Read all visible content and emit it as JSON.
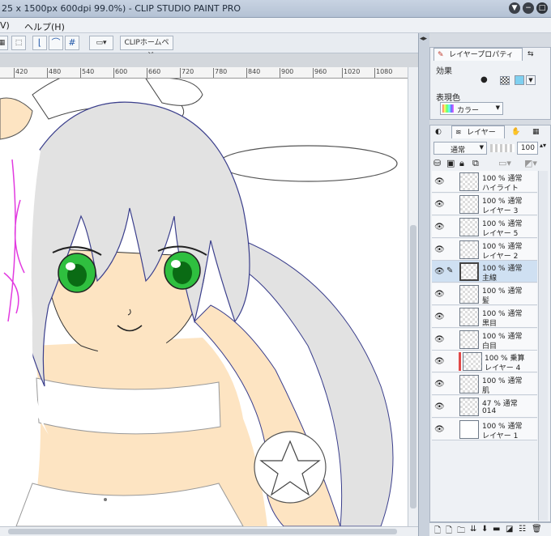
{
  "window": {
    "title": "25 x 1500px 600dpi 99.0%)  - CLIP STUDIO PAINT PRO",
    "controls": [
      "▼",
      "−",
      "□",
      "✕"
    ]
  },
  "menu": {
    "items": [
      "V)",
      "ヘルプ(H)"
    ]
  },
  "toolbar": {
    "clip_home_label": "CLIPホームページ"
  },
  "ruler": {
    "ticks": [
      "420",
      "480",
      "540",
      "600",
      "660",
      "720",
      "780",
      "840",
      "900",
      "960",
      "1020",
      "1080"
    ]
  },
  "layer_property": {
    "tab_label": "レイヤープロパティ",
    "effect_label": "効果",
    "express_color_label": "表現色",
    "color_mode_value": "カラー",
    "accent_color": "#7fd0f0"
  },
  "layers_panel": {
    "tab_label": "レイヤー",
    "blend_mode": "通常",
    "opacity": "100",
    "rows": [
      {
        "line1": "100 % 通常",
        "line2": "ハイライト"
      },
      {
        "line1": "100 % 通常",
        "line2": "レイヤー 3"
      },
      {
        "line1": "100 % 通常",
        "line2": "レイヤー 5"
      },
      {
        "line1": "100 % 通常",
        "line2": "レイヤー 2"
      },
      {
        "line1": "100 % 通常",
        "line2": "主線"
      },
      {
        "line1": "100 % 通常",
        "line2": "髪"
      },
      {
        "line1": "100 % 通常",
        "line2": "黒目"
      },
      {
        "line1": "100 % 通常",
        "line2": "白目"
      },
      {
        "line1": "100 % 乗算",
        "line2": "レイヤー 4"
      },
      {
        "line1": "100 % 通常",
        "line2": "肌"
      },
      {
        "line1": "47 % 通常",
        "line2": "014"
      },
      {
        "line1": "100 % 通常",
        "line2": "レイヤー 1"
      }
    ]
  }
}
